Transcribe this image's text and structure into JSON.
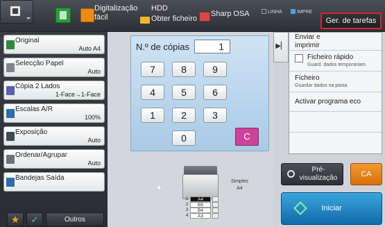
{
  "topbar": {
    "scan_easy": "Digitalização\nfácil",
    "hdd": "HDD",
    "obter": "Obter ficheiro",
    "sharp": "Sharp OSA",
    "linha": "LINHA",
    "impre": "IMPRE",
    "ger_tarefas": "Ger. de tarefas"
  },
  "left": {
    "items": [
      {
        "title": "Original",
        "value": "Auto  A4"
      },
      {
        "title": "Selecção Papel",
        "value": "Auto"
      },
      {
        "title": "Cópia 2 Lados",
        "value": "1-Face→1-Face"
      },
      {
        "title": "Escalas A/R",
        "value": "100%"
      },
      {
        "title": "Exposição",
        "value": "Auto"
      },
      {
        "title": "Ordenar/Agrupar",
        "value": "Auto"
      },
      {
        "title": "Bandejas Saída",
        "value": ""
      }
    ],
    "outros": "Outros"
  },
  "center": {
    "copies_label": "N.º de cópias",
    "copies_value": "1",
    "keys": [
      "7",
      "8",
      "9",
      "4",
      "5",
      "6",
      "1",
      "2",
      "3",
      "0"
    ],
    "clear": "C",
    "output_label": "Simples\nA4",
    "trays": [
      {
        "n": "1",
        "size": "A4",
        "selected": true
      },
      {
        "n": "2",
        "size": "B5",
        "selected": false
      },
      {
        "n": "3",
        "size": "B4",
        "selected": false
      },
      {
        "n": "4",
        "size": "A3",
        "selected": false
      }
    ]
  },
  "right": {
    "enviar": "Enviar e\nimprimir",
    "ficheiro_rapido": "Ficheiro rápido",
    "ficheiro_rapido_sub": "Guard. dados temporariam.",
    "ficheiro": "Ficheiro",
    "ficheiro_sub": "Guardar dados na pasta",
    "eco": "Activar programa eco"
  },
  "actions": {
    "preview": "Pré-\nvisualização",
    "ca": "CA",
    "start": "Iniciar"
  }
}
